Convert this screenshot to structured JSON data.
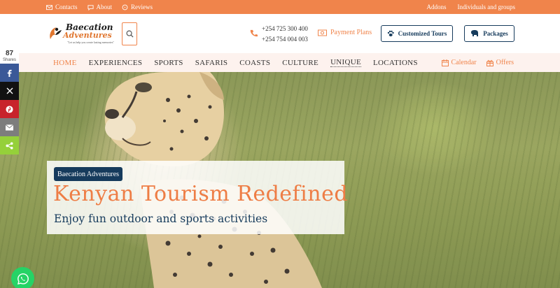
{
  "topbar": {
    "links": [
      "Contacts",
      "About",
      "Reviews"
    ],
    "right_links": [
      "Addons",
      "Individuals and groups"
    ]
  },
  "logo": {
    "line1": "Baecation",
    "line2": "Adventures",
    "tagline": "\"Let us help you create lasting memories\""
  },
  "header": {
    "phone1": "+254 725 300 400",
    "phone2": "+254 754 004 003",
    "payment_plans": "Payment Plans",
    "customized_tours": "Customized Tours",
    "packages": "Packages"
  },
  "nav": {
    "items": [
      "HOME",
      "EXPERIENCES",
      "SPORTS",
      "SAFARIS",
      "COASTS",
      "CULTURE",
      "UNIQUE",
      "LOCATIONS"
    ],
    "calendar": "Calendar",
    "offers": "Offers"
  },
  "hero": {
    "badge": "Baecation Adventures",
    "headline": "Kenyan Tourism Redefined",
    "subheadline": "Enjoy fun outdoor and sports activities"
  },
  "share": {
    "count": "87",
    "label": "Shares",
    "networks": [
      {
        "icon": "facebook-icon",
        "color": "#3b5998"
      },
      {
        "icon": "x-icon",
        "color": "#111111"
      },
      {
        "icon": "pinterest-icon",
        "color": "#c8232c"
      },
      {
        "icon": "email-icon",
        "color": "#7d7d7d"
      },
      {
        "icon": "sharethis-icon",
        "color": "#95d03a"
      }
    ]
  },
  "colors": {
    "accent": "#f0844b",
    "navy": "#163b5c",
    "whatsapp": "#25d366"
  }
}
